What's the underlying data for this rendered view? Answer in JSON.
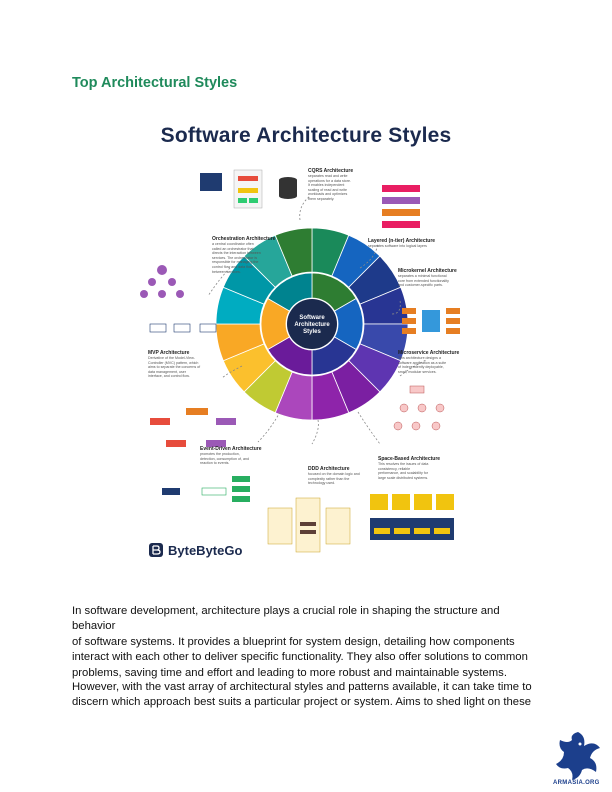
{
  "heading": "Top Architectural Styles",
  "figure": {
    "title": "Software Architecture Styles",
    "center_label": [
      "Software",
      "Architecture",
      "Styles"
    ],
    "sections": [
      {
        "title": "CQRS Architecture",
        "desc": [
          "separates read and write",
          "operations for a data store.",
          "It enables independent",
          "scaling of read and write",
          "workloads and optimizes",
          "them separately."
        ]
      },
      {
        "title": "Orchestration Architecture",
        "desc": [
          "a central coordinator often",
          "called an orchestrator that",
          "directs the interaction between",
          "services. The orchestrator is",
          "responsible for managing the",
          "control flow and data flow",
          "between services."
        ]
      },
      {
        "title": "Layered (n-tier) Architecture",
        "desc": [
          "separates software into logical layers"
        ]
      },
      {
        "title": "Microkernel Architecture",
        "desc": [
          "separates a minimal functional",
          "core from extended functionality",
          "and customer-specific parts."
        ]
      },
      {
        "title": "MVP Architecture",
        "desc": [
          "Derivative of the Model-View-",
          "Controller (MVC) pattern, which",
          "aims to separate the concerns of",
          "data management, user",
          "interface, and control flow."
        ]
      },
      {
        "title": "Microservice Architecture",
        "desc": [
          "This architecture designs a",
          "software application as a suite",
          "of independently deployable,",
          "small, modular services."
        ]
      },
      {
        "title": "Event-Driven Architecture",
        "desc": [
          "promotes the production,",
          "detection, consumption of, and",
          "reaction to events."
        ]
      },
      {
        "title": "DDD Architecture",
        "desc": [
          "focused on the domain logic and",
          "complexity rather than the",
          "technology used."
        ]
      },
      {
        "title": "Space-Based Architecture",
        "desc": [
          "This resolves the issues of data",
          "consistency, reliable",
          "performance, and scalability for",
          "large scale distributed systems."
        ]
      }
    ],
    "brand": "ByteByteGo"
  },
  "paragraphs": [
    [
      "In software development, architecture plays a crucial role in shaping the structure and behavior",
      "of software systems. It provides a blueprint for system design, detailing how components",
      "interact with each other to deliver specific functionality. They also offer solutions to common",
      "problems, saving time and effort and leading to more robust and maintainable systems."
    ],
    [
      "However, with the vast array of architectural styles and patterns available, it can take time to",
      "discern which approach best suits a particular project or system. Aims to shed light on these"
    ]
  ],
  "logo_text": "ARMASIA.ORG",
  "colors": {
    "heading": "#1f8a5b",
    "title": "#1b2a4e",
    "logo": "#1c3f8c"
  }
}
